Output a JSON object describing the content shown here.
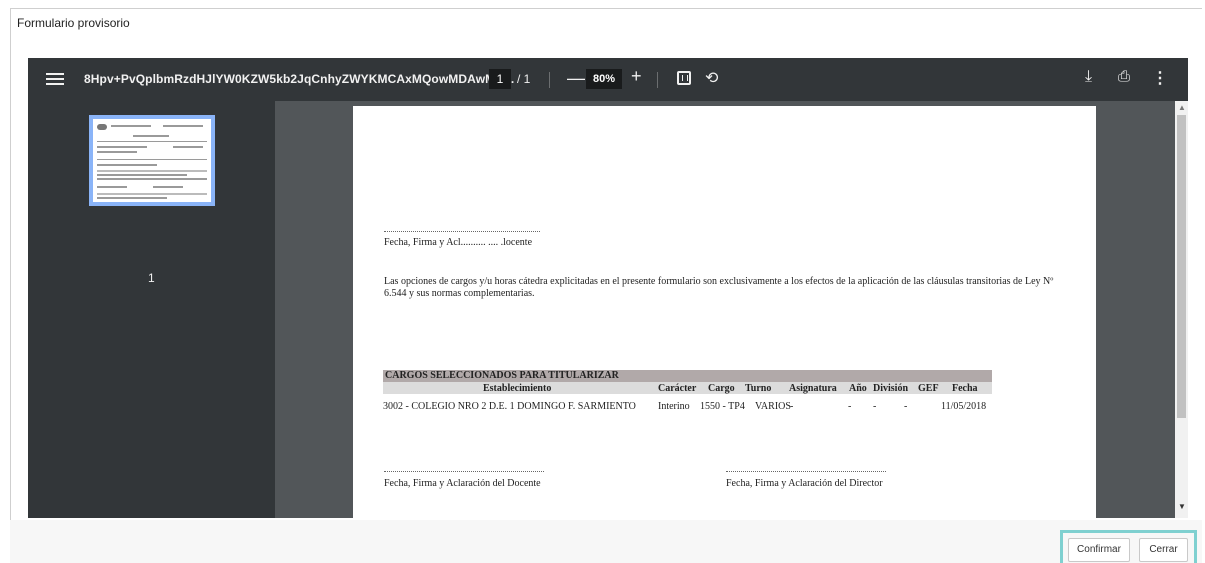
{
  "modal": {
    "title": "Formulario provisorio"
  },
  "toolbar": {
    "filename": "8Hpv+PvQplbmRzdHJlYW0KZW5kb2JqCnhyZWYKMCAxMQowMDAwMD...",
    "page_current": "1",
    "page_total": "/ 1",
    "zoom": "80%",
    "icons": [
      "menu-icon",
      "zoom-out-icon",
      "zoom-in-icon",
      "fit-page-icon",
      "rotate-icon",
      "download-icon",
      "print-icon",
      "more-vert-icon"
    ]
  },
  "sidebar": {
    "thumbnail_label": "1"
  },
  "document": {
    "sig_top_label": "Fecha, Firma y Acl..........  ....  .locente",
    "paragraph": "Las opciones de cargos y/u horas cátedra explicitadas en el presente formulario son exclusivamente a los efectos de la aplicación de las cláusulas transitorias de Ley Nº 6.544 y sus normas complementarias.",
    "section_title": "CARGOS SELECCIONADOS PARA TITULARIZAR",
    "table": {
      "headers": [
        "Establecimiento",
        "Carácter",
        "Cargo",
        "Turno",
        "Asignatura",
        "Año",
        "División",
        "GEF",
        "Fecha"
      ],
      "rows": [
        [
          "3002 - COLEGIO NRO 2 D.E. 1 DOMINGO F. SARMIENTO",
          "Interino",
          "1550 - TP4",
          "VARIOS",
          "-",
          "-",
          "-",
          "-",
          "11/05/2018"
        ]
      ]
    },
    "sig_docente_label": "Fecha, Firma y Aclaración del Docente",
    "sig_director_label": "Fecha, Firma y Aclaración del Director"
  },
  "footer": {
    "confirm_label": "Confirmar",
    "close_label": "Cerrar"
  }
}
